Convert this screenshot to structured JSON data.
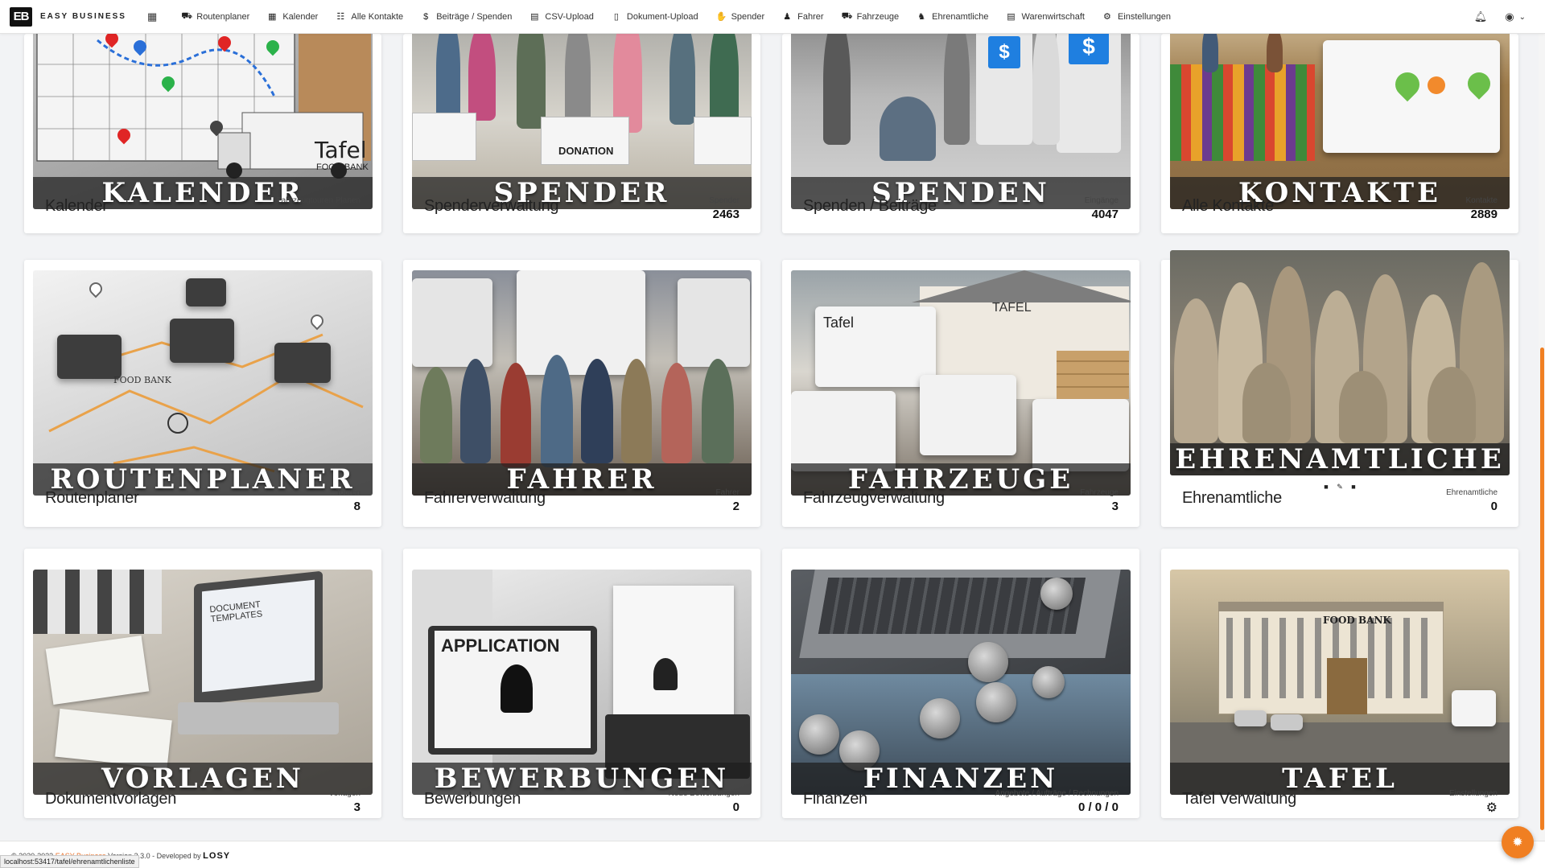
{
  "brand": {
    "logo": "EB",
    "name": "EASY BUSINESS"
  },
  "nav": {
    "apps_icon": "grid-icon",
    "items": [
      {
        "label": "Routenplaner",
        "icon": "route-icon"
      },
      {
        "label": "Kalender",
        "icon": "calendar-icon"
      },
      {
        "label": "Alle Kontakte",
        "icon": "contacts-icon"
      },
      {
        "label": "Beiträge / Spenden",
        "icon": "dollar-icon"
      },
      {
        "label": "CSV-Upload",
        "icon": "file-icon"
      },
      {
        "label": "Dokument-Upload",
        "icon": "document-icon"
      },
      {
        "label": "Spender",
        "icon": "donor-icon"
      },
      {
        "label": "Fahrer",
        "icon": "user-icon"
      },
      {
        "label": "Fahrzeuge",
        "icon": "truck-icon"
      },
      {
        "label": "Ehrenamtliche",
        "icon": "users-icon"
      },
      {
        "label": "Warenwirtschaft",
        "icon": "file-icon"
      },
      {
        "label": "Einstellungen",
        "icon": "gears-icon"
      }
    ],
    "right": {
      "notification_icon": "bell-icon",
      "account_icon": "user-circle-icon",
      "chevron": "chevron-down-icon"
    }
  },
  "cards": [
    {
      "banner": "Kalender",
      "title": "Kalender",
      "meta_label": "Fahrzeugtouren Planen",
      "meta_value": ""
    },
    {
      "banner": "Spender",
      "title": "Spenderverwaltung",
      "meta_label": "Spender",
      "meta_value": "2463"
    },
    {
      "banner": "Spenden",
      "title": "Spenden / Beiträge",
      "meta_label": "Eingänge",
      "meta_value": "4047"
    },
    {
      "banner": "Kontakte",
      "title": "Alle Kontakte",
      "meta_label": "Kontakte",
      "meta_value": "2889"
    },
    {
      "banner": "Routenplaner",
      "title": "Routenplaner",
      "meta_label": "Touren",
      "meta_value": "8"
    },
    {
      "banner": "Fahrer",
      "title": "Fahrerverwaltung",
      "meta_label": "Fahrer",
      "meta_value": "2"
    },
    {
      "banner": "Fahrzeuge",
      "title": "Fahrzeugverwaltung",
      "meta_label": "Fahrzeuge",
      "meta_value": "3"
    },
    {
      "banner": "Ehrenamtliche",
      "title": "Ehrenamtliche",
      "meta_label": "Ehrenamtliche",
      "meta_value": "0"
    },
    {
      "banner": "Vorlagen",
      "title": "Dokumentvorlagen",
      "meta_label": "Vorlagen",
      "meta_value": "3"
    },
    {
      "banner": "Bewerbungen",
      "title": "Bewerbungen",
      "meta_label": "Neue Bewerbungen",
      "meta_value": "0"
    },
    {
      "banner": "Finanzen",
      "title": "Finanzen",
      "meta_label": "Angebote / Aufträge / Rechnungen",
      "meta_value": "0 / 0 / 0"
    },
    {
      "banner": "Tafel",
      "title": "Tafel Verwaltung",
      "meta_label": "Einstellungen",
      "meta_value": ""
    }
  ],
  "scene_text": {
    "kalender_sign": "Tafel",
    "kalender_sign2": "FOOD BANK",
    "spender_box": "DONATION",
    "fahrzeuge_house": "TAFEL",
    "fahrzeuge_truck": "Tafel",
    "routen_van": "FOOD BANK",
    "vorlagen_screen": "DOCUMENT TEMPLATES",
    "bewerb_screen": "APPLICATION",
    "tafel_building": "FOOD BANK"
  },
  "footer": {
    "copyright": "© 2020-2023",
    "brand": "EASY Business",
    "version": "Version 3.3.0 - Developed by",
    "dev_logo": "LOSY",
    "status_url": "localhost:53417/tafel/ehrenamtlichenliste"
  },
  "fab_icon": "bug-icon"
}
